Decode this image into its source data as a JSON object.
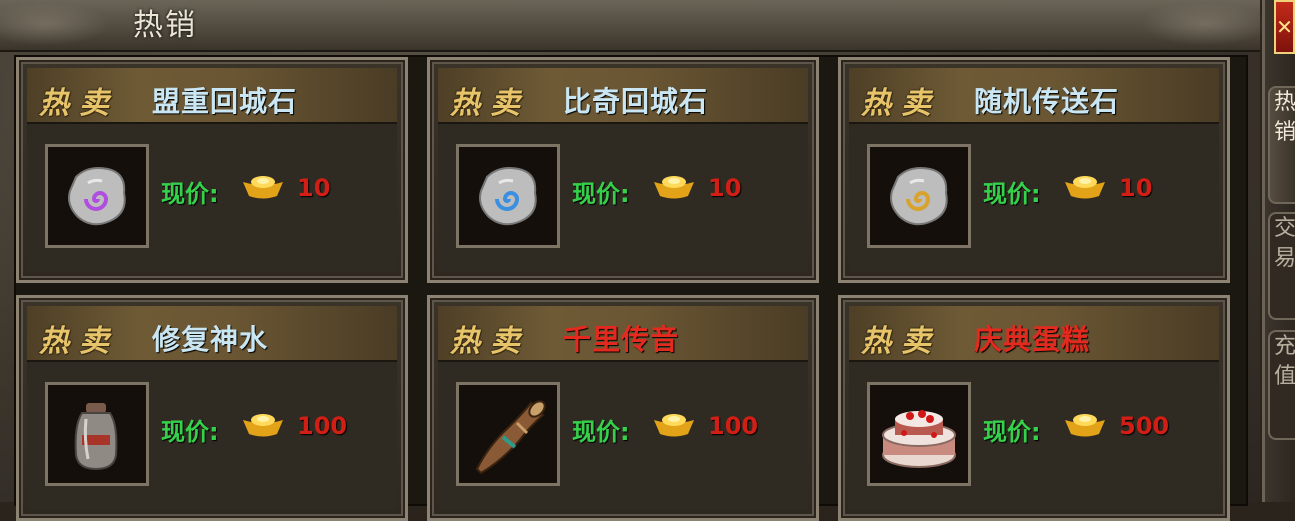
{
  "window": {
    "title": "热销"
  },
  "side_tabs": [
    "热销",
    "交易",
    "充值"
  ],
  "close_label": "✕",
  "products": [
    {
      "hot_label": "热卖",
      "name": "盟重回城石",
      "price_label": "现价:",
      "price": "10",
      "name_color": "blue",
      "icon": "stone-purple-icon",
      "swirl": "#b04ee0"
    },
    {
      "hot_label": "热卖",
      "name": "比奇回城石",
      "price_label": "现价:",
      "price": "10",
      "name_color": "blue",
      "icon": "stone-blue-icon",
      "swirl": "#3a8fe0"
    },
    {
      "hot_label": "热卖",
      "name": "随机传送石",
      "price_label": "现价:",
      "price": "10",
      "name_color": "blue",
      "icon": "stone-gold-icon",
      "swirl": "#d9a22a"
    },
    {
      "hot_label": "热卖",
      "name": "修复神水",
      "price_label": "现价:",
      "price": "100",
      "name_color": "blue",
      "icon": "potion-bottle-icon"
    },
    {
      "hot_label": "热卖",
      "name": "千里传音",
      "price_label": "现价:",
      "price": "100",
      "name_color": "red",
      "icon": "horn-icon"
    },
    {
      "hot_label": "热卖",
      "name": "庆典蛋糕",
      "price_label": "现价:",
      "price": "500",
      "name_color": "red",
      "icon": "cake-icon"
    }
  ],
  "currency_icon": "gold-ingot-icon"
}
